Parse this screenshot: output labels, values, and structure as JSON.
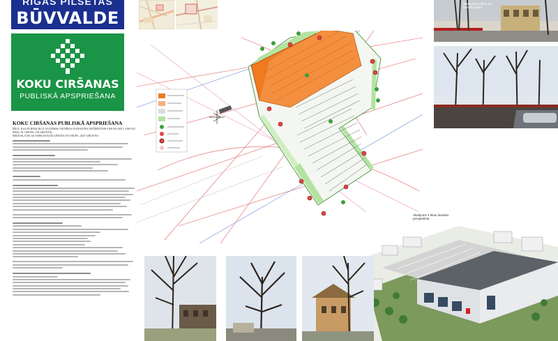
{
  "brand": {
    "top_line": "RĪGAS PILSĒTAS",
    "main_line": "BŪVVALDE"
  },
  "badge": {
    "title": "KOKU CIRŠANAS",
    "subtitle": "PUBLISKĀ APSPRIEŠANA"
  },
  "document": {
    "title": "KOKU CIRŠANAS PUBLISKĀ APSPRIEŠANA",
    "address_1": "RĪGĀ, KALNCIEMA IELĀ 50 (ZEMES VIENĪBAS KADASTRA APZĪMĒJUMS 0100 041 0091, 0100 041 0092), 59. GRUPA, (50 GRUNTS),",
    "address_2": "MEIJUSĻA IELAS SARKANAJĀS LĪNIJĀS (59 GRUPA, 2047 GRUNTS)"
  },
  "photo_captions": {
    "p1": "Skatījums 4 ēkas no kreisās puses",
    "p2": "",
    "p3": "Skatījums 4 ēkas fasades perspektīvā"
  },
  "colors": {
    "brand_blue": "#1b2f8f",
    "badge_green": "#1a9446",
    "building_orange": "#f07a1e",
    "greenery": "#b4e3a1",
    "tree_marker": "#d42a2a"
  }
}
